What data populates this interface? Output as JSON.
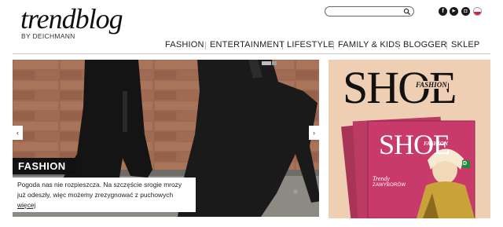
{
  "header": {
    "logo_text": "trendblog",
    "logo_subtitle": "BY DEICHMANN",
    "search": {
      "placeholder": ""
    },
    "social": [
      {
        "name": "facebook-icon",
        "glyph": "f"
      },
      {
        "name": "youtube-icon",
        "glyph": "▶"
      },
      {
        "name": "instagram-icon",
        "glyph": "◘"
      }
    ],
    "language_flag": "pl-flag-icon"
  },
  "nav": {
    "items": [
      "FASHION",
      "ENTERTAINMENT",
      "LIFESTYLE",
      "FAMILY & KIDS",
      "BLOGGER",
      "SKLEP"
    ]
  },
  "hero": {
    "category": "FASHION",
    "caption": "Pogoda nas nie rozpieszcza. Na szczęście srogie mrozy już odeszły, więc możemy zrezygnować z puchowych",
    "more_link": "więcej",
    "prev_arrow": "‹",
    "next_arrow": "›"
  },
  "ad": {
    "title": "SHOE",
    "title_badge": "FASHION",
    "magazine_title": "SHOE",
    "magazine_badge": "FASHION",
    "magazine_line1": "Trendy",
    "magazine_line2": "ZAWYBORÓW",
    "magazine_side": "D"
  },
  "colors": {
    "brick": "#8a5a44",
    "ad_background": "#efcfb4",
    "magazine_pink": "#c83a6a",
    "flag_red": "#d4213d"
  }
}
